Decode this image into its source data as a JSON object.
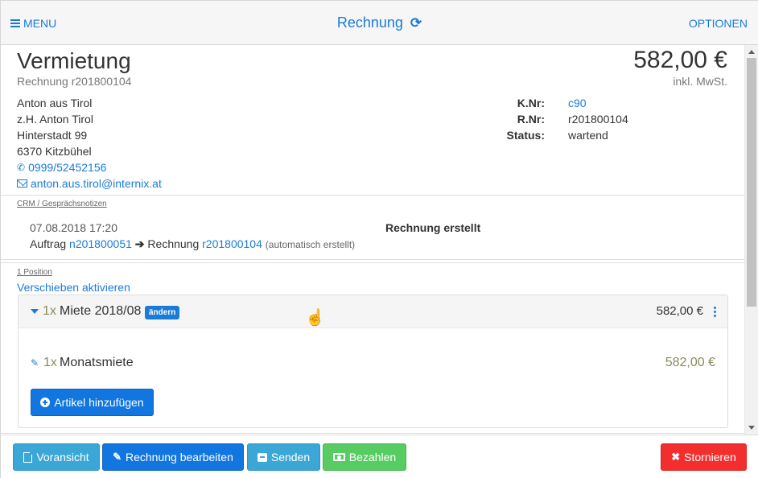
{
  "topbar": {
    "menu_label": "MENU",
    "title": "Rechnung",
    "refresh_glyph": "⟳",
    "options_label": "OPTIONEN"
  },
  "document": {
    "type_title": "Vermietung",
    "subtitle": "Rechnung r201800104",
    "total": "582,00 €",
    "total_note": "inkl. MwSt."
  },
  "customer": {
    "name": "Anton aus Tirol",
    "attention": "z.H. Anton Tirol",
    "street": "Hinterstadt 99",
    "city": "6370 Kitzbühel",
    "phone": "0999/52452156",
    "email": "anton.aus.tirol@internix.at"
  },
  "meta": {
    "knr_label": "K.Nr:",
    "knr_value": "c90",
    "rnr_label": "R.Nr:",
    "rnr_value": "r201800104",
    "status_label": "Status:",
    "status_value": "wartend"
  },
  "crm": {
    "section_label": "CRM / Gesprächsnotizen",
    "date": "07.08.2018 17:20",
    "title": "Rechnung erstellt",
    "from_label": "Auftrag",
    "from_link": "n201800051",
    "arrow": "➔",
    "to_label": "Rechnung",
    "to_link": "r201800104",
    "note": "(automatisch erstellt)"
  },
  "positions": {
    "count_label": "1 Position",
    "activate_link": "Verschieben aktivieren",
    "group": {
      "qty": "1x",
      "name": "Miete 2018/08",
      "edit_badge": "ändern",
      "price": "582,00 €"
    },
    "line": {
      "qty": "1x",
      "name": "Monatsmiete",
      "price": "582,00 €"
    },
    "add_button": "Artikel hinzufügen"
  },
  "actions": {
    "preview": "Voransicht",
    "edit": "Rechnung bearbeiten",
    "send": "Senden",
    "pay": "Bezahlen",
    "cancel": "Stornieren"
  },
  "icons": {
    "phone": "✆",
    "pencil": "✎",
    "edit_pencil": "✎",
    "cancel_x": "✖",
    "hand_cursor": "☝"
  },
  "colors": {
    "link_blue": "#1a7bd8",
    "primary": "#1276e0",
    "info": "#3aa7d6",
    "success": "#57cc62",
    "danger": "#f32e2e",
    "qty_olive": "#8a8a5a"
  }
}
